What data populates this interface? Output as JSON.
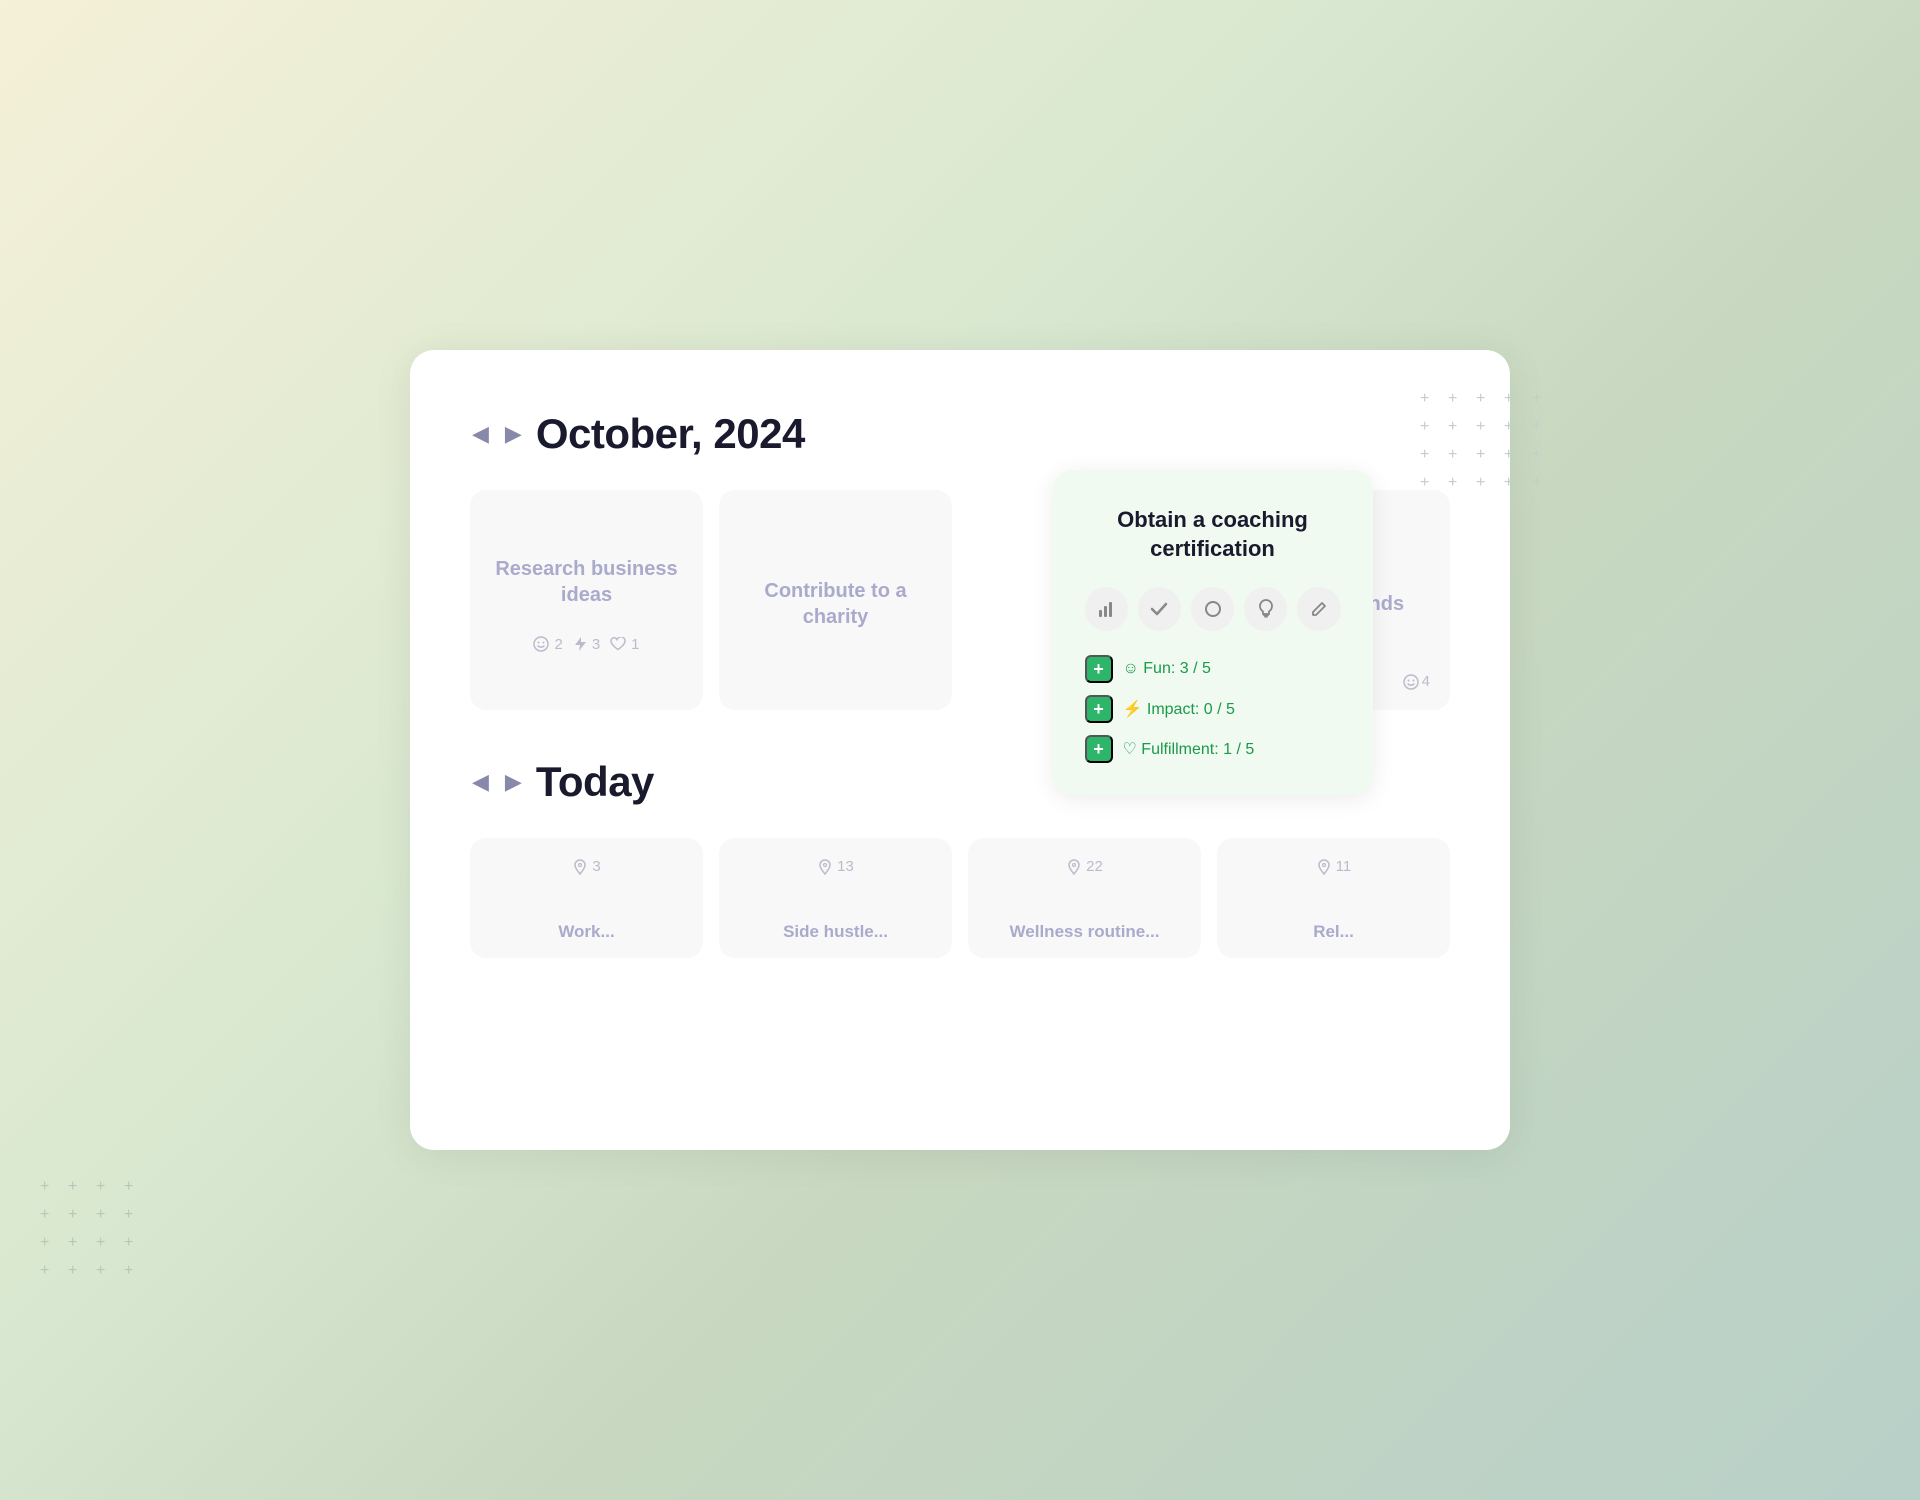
{
  "background": {
    "gradient": "linear-gradient(135deg, #f5f0d8, #d8e8d0, #c8d8c0, #b8d0c8)"
  },
  "october_section": {
    "nav_prev": "◀",
    "nav_next": "▶",
    "title": "October, 2024"
  },
  "october_cards": [
    {
      "id": "card-research",
      "title": "Research business ideas",
      "stats": [
        {
          "icon": "smiley",
          "value": "2"
        },
        {
          "icon": "bolt",
          "value": "3"
        },
        {
          "icon": "heart",
          "value": "1"
        }
      ]
    },
    {
      "id": "card-charity",
      "title": "Contribute to a charity",
      "stats": []
    },
    {
      "id": "card-coaching",
      "title": "Obtain a coaching certification",
      "is_popup": true,
      "popup": {
        "title": "Obtain a coaching certification",
        "icons": [
          {
            "id": "chart-icon",
            "symbol": "▐",
            "label": "chart-icon"
          },
          {
            "id": "check-icon",
            "symbol": "✓",
            "label": "check-icon"
          },
          {
            "id": "circle-icon",
            "symbol": "○",
            "label": "circle-icon"
          },
          {
            "id": "bulb-icon",
            "symbol": "💡",
            "label": "bulb-icon"
          },
          {
            "id": "pencil-icon",
            "symbol": "✏",
            "label": "pencil-icon"
          }
        ],
        "metrics": [
          {
            "id": "fun",
            "plus_label": "+",
            "icon": "☺",
            "label": "Fun: 3 / 5",
            "type": "fun"
          },
          {
            "id": "impact",
            "plus_label": "+",
            "icon": "⚡",
            "label": "Impact: 0 / 5",
            "type": "impact"
          },
          {
            "id": "fulfillment",
            "plus_label": "+",
            "icon": "♡",
            "label": "Fulfillment: 1 / 5",
            "type": "fulfillment"
          }
        ]
      }
    },
    {
      "id": "card-lose",
      "title": "Lose 5 pounds",
      "stats": [
        {
          "icon": "smiley",
          "value": "4"
        }
      ],
      "partial": true
    }
  ],
  "today_section": {
    "nav_prev": "◀",
    "nav_next": "▶",
    "title": "Today"
  },
  "today_cards": [
    {
      "id": "today-1",
      "stat": "3",
      "label": "Work..."
    },
    {
      "id": "today-2",
      "stat": "13",
      "label": "Side hustle..."
    },
    {
      "id": "today-3",
      "stat": "22",
      "label": "Wellness routine..."
    },
    {
      "id": "today-4",
      "stat": "11",
      "label": "Rel..."
    }
  ],
  "deco": {
    "plus_char": "+",
    "plus_count_tr": 20,
    "plus_count_bl": 16
  }
}
